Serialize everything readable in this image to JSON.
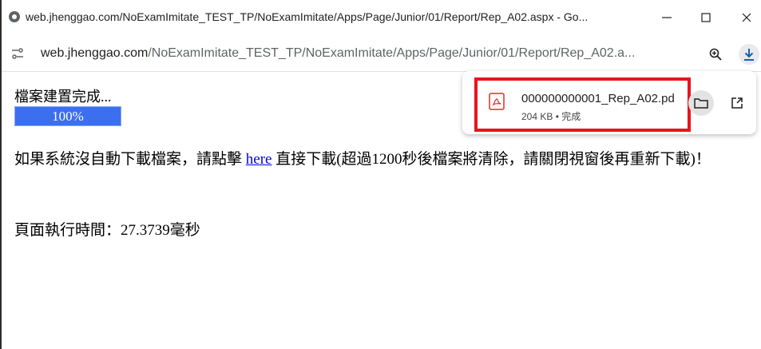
{
  "window": {
    "title": "web.jhenggao.com/NoExamImitate_TEST_TP/NoExamImitate/Apps/Page/Junior/01/Report/Rep_A02.aspx - Go...",
    "minimize_icon": "minimize-icon",
    "maximize_icon": "maximize-icon",
    "close_icon": "close-icon"
  },
  "addressbar": {
    "url_host": "web.jhenggao.com",
    "url_path": "/NoExamImitate_TEST_TP/NoExamImitate/Apps/Page/Junior/01/Report/Rep_A02.a...",
    "site_info_icon": "tune-icon",
    "zoom_icon": "zoom-icon",
    "download_icon": "download-icon"
  },
  "page": {
    "status_text": "檔案建置完成...",
    "progress": {
      "label": "100%",
      "value": 1.0,
      "color": "#3b6ff0"
    },
    "message_before": "如果系統沒自動下載檔案，請點擊 ",
    "link_text": "here",
    "message_after": " 直接下載(超過1200秒後檔案將清除，請關閉視窗後再重新下載)！",
    "exec_time": "頁面執行時間：27.3739毫秒"
  },
  "download": {
    "filename": "000000000001_Rep_A02.pd",
    "meta": "204 KB • 完成",
    "highlight_color": "#e8141c"
  }
}
